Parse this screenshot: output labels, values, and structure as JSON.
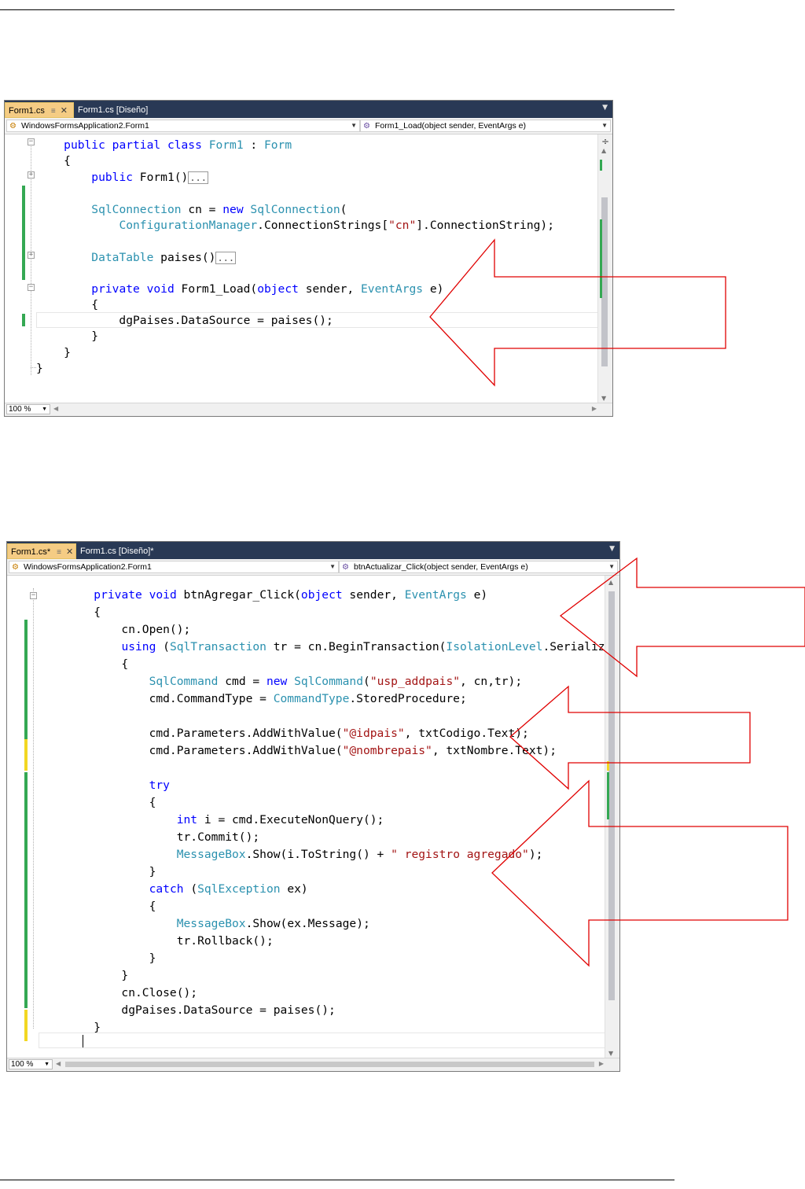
{
  "screens": [
    {
      "tabs": [
        {
          "label": "Form1.cs",
          "pin": "≡",
          "close": "✕"
        },
        {
          "label": "Form1.cs [Diseño]"
        }
      ],
      "nav_class": "WindowsFormsApplication2.Form1",
      "nav_member": "Form1_Load(object sender, EventArgs e)",
      "zoom": "100 %"
    },
    {
      "tabs": [
        {
          "label": "Form1.cs*",
          "pin": "≡",
          "close": "✕"
        },
        {
          "label": "Form1.cs [Diseño]*"
        }
      ],
      "nav_class": "WindowsFormsApplication2.Form1",
      "nav_member": "btnActualizar_Click(object sender, EventArgs e)",
      "zoom": "100 %"
    }
  ],
  "code1": {
    "l1": {
      "a": "    ",
      "b": "public partial class",
      "c": " ",
      "d": "Form1",
      "e": " : ",
      "f": "Form"
    },
    "l2": {
      "a": "    {"
    },
    "l3": {
      "a": "        ",
      "b": "public",
      "c": " Form1()",
      "d": "..."
    },
    "l5": {
      "a": "        ",
      "b": "SqlConnection",
      "c": " cn = ",
      "d": "new",
      "e": " ",
      "f": "SqlConnection",
      "g": "("
    },
    "l6": {
      "a": "            ",
      "b": "ConfigurationManager",
      "c": ".ConnectionStrings[",
      "d": "\"cn\"",
      "e": "].ConnectionString);"
    },
    "l8": {
      "a": "        ",
      "b": "DataTable",
      "c": " paises()",
      "d": "..."
    },
    "l10": {
      "a": "        ",
      "b": "private",
      "c": " ",
      "d": "void",
      "e": " Form1_Load(",
      "f": "object",
      "g": " sender, ",
      "h": "EventArgs",
      "i": " e)"
    },
    "l11": {
      "a": "        {"
    },
    "l12": {
      "a": "            dgPaises.DataSource = paises();"
    },
    "l13": {
      "a": "        }"
    },
    "l14": {
      "a": "    }"
    },
    "l15": {
      "a": "}"
    }
  },
  "code2": {
    "l1": {
      "a": "        ",
      "b": "private",
      "c": " ",
      "d": "void",
      "e": " btnAgregar_Click(",
      "f": "object",
      "g": " sender, ",
      "h": "EventArgs",
      "i": " e)"
    },
    "l2": {
      "a": "        {"
    },
    "l3": {
      "a": "            cn.Open();"
    },
    "l4": {
      "a": "            ",
      "b": "using",
      "c": " (",
      "d": "SqlTransaction",
      "e": " tr = cn.BeginTransaction(",
      "f": "IsolationLevel",
      "g": ".Serializable))"
    },
    "l5": {
      "a": "            {"
    },
    "l6": {
      "a": "                ",
      "b": "SqlCommand",
      "c": " cmd = ",
      "d": "new",
      "e": " ",
      "f": "SqlCommand",
      "g": "(",
      "h": "\"usp_addpais\"",
      "i": ", cn,tr);"
    },
    "l7": {
      "a": "                cmd.CommandType = ",
      "b": "CommandType",
      "c": ".StoredProcedure;"
    },
    "l9": {
      "a": "                cmd.Parameters.AddWithValue(",
      "b": "\"@idpais\"",
      "c": ", txtCodigo.Text);"
    },
    "l10": {
      "a": "                cmd.Parameters.AddWithValue(",
      "b": "\"@nombrepais\"",
      "c": ", txtNombre.Text);"
    },
    "l12": {
      "a": "                ",
      "b": "try"
    },
    "l13": {
      "a": "                {"
    },
    "l14": {
      "a": "                    ",
      "b": "int",
      "c": " i = cmd.ExecuteNonQuery();"
    },
    "l15": {
      "a": "                    tr.Commit();"
    },
    "l16": {
      "a": "                    ",
      "b": "MessageBox",
      "c": ".Show(i.ToString() + ",
      "d": "\" registro agregado\"",
      "e": ");"
    },
    "l17": {
      "a": "                }"
    },
    "l18": {
      "a": "                ",
      "b": "catch",
      "c": " (",
      "d": "SqlException",
      "e": " ex)"
    },
    "l19": {
      "a": "                {"
    },
    "l20": {
      "a": "                    ",
      "b": "MessageBox",
      "c": ".Show(ex.Message);"
    },
    "l21": {
      "a": "                    tr.Rollback();"
    },
    "l22": {
      "a": "                }"
    },
    "l23": {
      "a": "            }"
    },
    "l24": {
      "a": "            cn.Close();"
    },
    "l25": {
      "a": "            dgPaises.DataSource = paises();"
    },
    "l26": {
      "a": "        }"
    }
  },
  "colors": {
    "tab_strip": "#293955",
    "active_tab": "#f5cc84",
    "keyword": "#0000ff",
    "type": "#2b91af",
    "string": "#a31515",
    "saved_change": "#34a853",
    "unsaved_change": "#f2d722",
    "annotation_arrow": "#e00000"
  },
  "icons": {
    "class_icon": "class-icon",
    "method_icon": "method-icon",
    "annotation": "left-arrow-outline"
  }
}
